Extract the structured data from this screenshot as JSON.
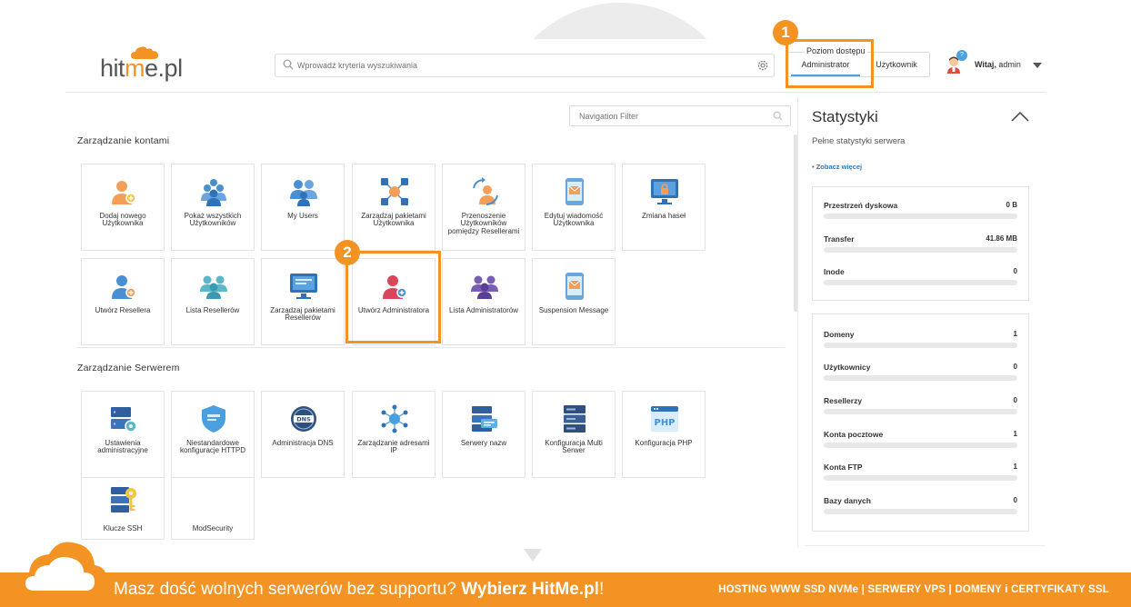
{
  "header": {
    "logo": {
      "pre": "hit",
      "accent": "m",
      "post": "e.pl"
    },
    "search_placeholder": "Wprowadź kryteria wyszukiwania",
    "access": {
      "title": "Poziom dostępu",
      "admin": "Administrator",
      "user": "Użytkownik"
    },
    "user": {
      "greeting": "Witaj,",
      "name": " admin",
      "notification_count": "?"
    }
  },
  "callouts": {
    "one": "1",
    "two": "2"
  },
  "nav_filter_placeholder": "Navigation Filter",
  "sections": {
    "accounts": {
      "title": "Zarządzanie kontami",
      "tiles": [
        {
          "label": "Dodaj nowego Użytkownika",
          "icon": "add-user-icon"
        },
        {
          "label": "Pokaż wszystkich Użytkowników",
          "icon": "users-group-icon"
        },
        {
          "label": "My Users",
          "icon": "my-users-icon"
        },
        {
          "label": "Zarządzaj pakietami Użytkownika",
          "icon": "package-network-icon"
        },
        {
          "label": "Przenoszenie Użytkowników pomiędzy Resellerami",
          "icon": "transfer-users-icon"
        },
        {
          "label": "Edytuj wiadomość Użytkownika",
          "icon": "message-phone-icon"
        },
        {
          "label": "Zmiana haseł",
          "icon": "password-monitor-icon"
        },
        {
          "label": "Utwórz Resellera",
          "icon": "add-reseller-icon"
        },
        {
          "label": "Lista Resellerów",
          "icon": "reseller-list-icon"
        },
        {
          "label": "Zarządzaj pakietami Resellerów",
          "icon": "reseller-packages-icon"
        },
        {
          "label": "Utwórz Administratora",
          "icon": "add-admin-icon"
        },
        {
          "label": "Lista Administratorów",
          "icon": "admin-list-icon"
        },
        {
          "label": "Suspension Message",
          "icon": "suspension-message-icon"
        }
      ]
    },
    "server": {
      "title": "Zarządzanie Serwerem",
      "tiles": [
        {
          "label": "Ustawienia administracyjne",
          "icon": "server-settings-icon"
        },
        {
          "label": "Niestandardowe konfiguracje HTTPD",
          "icon": "httpd-shield-icon"
        },
        {
          "label": "Administracja DNS",
          "icon": "dns-icon"
        },
        {
          "label": "Zarządzanie adresami IP",
          "icon": "ip-network-icon"
        },
        {
          "label": "Serwery nazw",
          "icon": "nameservers-icon"
        },
        {
          "label": "Konfiguracja Multi Serwer",
          "icon": "multi-server-icon"
        },
        {
          "label": "Konfiguracja PHP",
          "icon": "php-icon"
        },
        {
          "label": "Klucze SSH",
          "icon": "ssh-key-icon"
        },
        {
          "label": "ModSecurity",
          "icon": "modsecurity-icon"
        }
      ]
    }
  },
  "stats": {
    "title": "Statystyki",
    "subtitle": "Pełne statystyki serwera",
    "more": "• Zobacz więcej",
    "box1": [
      {
        "name": "Przestrzeń dyskowa",
        "value": "0 B"
      },
      {
        "name": "Transfer",
        "value": "41.86 MB"
      },
      {
        "name": "Inode",
        "value": "0"
      }
    ],
    "box2": [
      {
        "name": "Domeny",
        "value": "1"
      },
      {
        "name": "Użytkownicy",
        "value": "0"
      },
      {
        "name": "Resellerzy",
        "value": "0"
      },
      {
        "name": "Konta pocztowe",
        "value": "1"
      },
      {
        "name": "Konta FTP",
        "value": "1"
      },
      {
        "name": "Bazy danych",
        "value": "0"
      }
    ]
  },
  "banner": {
    "text": "Masz dość wolnych serwerów bez supportu? ",
    "bold": "Wybierz HitMe.pl",
    "end": "!",
    "right": "HOSTING WWW SSD NVMe | SERWERY VPS | DOMENY i CERTYFIKATY SSL"
  },
  "colors": {
    "accent": "#f39323",
    "link": "#2a7ab8",
    "tab_underline": "#4aa3df"
  }
}
